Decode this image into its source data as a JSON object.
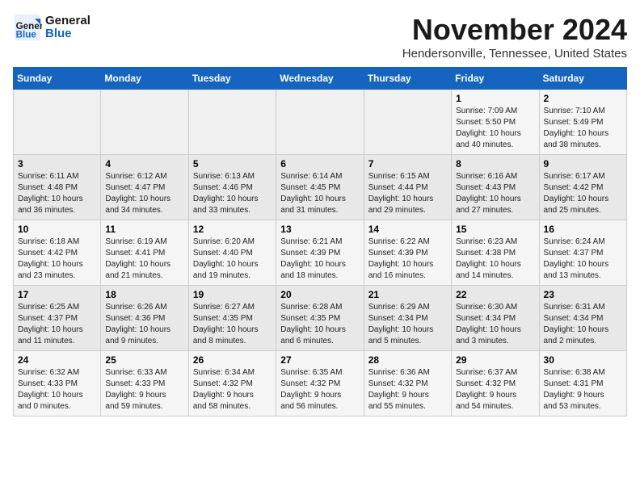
{
  "logo": {
    "line1": "General",
    "line2": "Blue"
  },
  "title": "November 2024",
  "location": "Hendersonville, Tennessee, United States",
  "days_of_week": [
    "Sunday",
    "Monday",
    "Tuesday",
    "Wednesday",
    "Thursday",
    "Friday",
    "Saturday"
  ],
  "weeks": [
    [
      {
        "num": "",
        "info": ""
      },
      {
        "num": "",
        "info": ""
      },
      {
        "num": "",
        "info": ""
      },
      {
        "num": "",
        "info": ""
      },
      {
        "num": "",
        "info": ""
      },
      {
        "num": "1",
        "info": "Sunrise: 7:09 AM\nSunset: 5:50 PM\nDaylight: 10 hours\nand 40 minutes."
      },
      {
        "num": "2",
        "info": "Sunrise: 7:10 AM\nSunset: 5:49 PM\nDaylight: 10 hours\nand 38 minutes."
      }
    ],
    [
      {
        "num": "3",
        "info": "Sunrise: 6:11 AM\nSunset: 4:48 PM\nDaylight: 10 hours\nand 36 minutes."
      },
      {
        "num": "4",
        "info": "Sunrise: 6:12 AM\nSunset: 4:47 PM\nDaylight: 10 hours\nand 34 minutes."
      },
      {
        "num": "5",
        "info": "Sunrise: 6:13 AM\nSunset: 4:46 PM\nDaylight: 10 hours\nand 33 minutes."
      },
      {
        "num": "6",
        "info": "Sunrise: 6:14 AM\nSunset: 4:45 PM\nDaylight: 10 hours\nand 31 minutes."
      },
      {
        "num": "7",
        "info": "Sunrise: 6:15 AM\nSunset: 4:44 PM\nDaylight: 10 hours\nand 29 minutes."
      },
      {
        "num": "8",
        "info": "Sunrise: 6:16 AM\nSunset: 4:43 PM\nDaylight: 10 hours\nand 27 minutes."
      },
      {
        "num": "9",
        "info": "Sunrise: 6:17 AM\nSunset: 4:42 PM\nDaylight: 10 hours\nand 25 minutes."
      }
    ],
    [
      {
        "num": "10",
        "info": "Sunrise: 6:18 AM\nSunset: 4:42 PM\nDaylight: 10 hours\nand 23 minutes."
      },
      {
        "num": "11",
        "info": "Sunrise: 6:19 AM\nSunset: 4:41 PM\nDaylight: 10 hours\nand 21 minutes."
      },
      {
        "num": "12",
        "info": "Sunrise: 6:20 AM\nSunset: 4:40 PM\nDaylight: 10 hours\nand 19 minutes."
      },
      {
        "num": "13",
        "info": "Sunrise: 6:21 AM\nSunset: 4:39 PM\nDaylight: 10 hours\nand 18 minutes."
      },
      {
        "num": "14",
        "info": "Sunrise: 6:22 AM\nSunset: 4:39 PM\nDaylight: 10 hours\nand 16 minutes."
      },
      {
        "num": "15",
        "info": "Sunrise: 6:23 AM\nSunset: 4:38 PM\nDaylight: 10 hours\nand 14 minutes."
      },
      {
        "num": "16",
        "info": "Sunrise: 6:24 AM\nSunset: 4:37 PM\nDaylight: 10 hours\nand 13 minutes."
      }
    ],
    [
      {
        "num": "17",
        "info": "Sunrise: 6:25 AM\nSunset: 4:37 PM\nDaylight: 10 hours\nand 11 minutes."
      },
      {
        "num": "18",
        "info": "Sunrise: 6:26 AM\nSunset: 4:36 PM\nDaylight: 10 hours\nand 9 minutes."
      },
      {
        "num": "19",
        "info": "Sunrise: 6:27 AM\nSunset: 4:35 PM\nDaylight: 10 hours\nand 8 minutes."
      },
      {
        "num": "20",
        "info": "Sunrise: 6:28 AM\nSunset: 4:35 PM\nDaylight: 10 hours\nand 6 minutes."
      },
      {
        "num": "21",
        "info": "Sunrise: 6:29 AM\nSunset: 4:34 PM\nDaylight: 10 hours\nand 5 minutes."
      },
      {
        "num": "22",
        "info": "Sunrise: 6:30 AM\nSunset: 4:34 PM\nDaylight: 10 hours\nand 3 minutes."
      },
      {
        "num": "23",
        "info": "Sunrise: 6:31 AM\nSunset: 4:34 PM\nDaylight: 10 hours\nand 2 minutes."
      }
    ],
    [
      {
        "num": "24",
        "info": "Sunrise: 6:32 AM\nSunset: 4:33 PM\nDaylight: 10 hours\nand 0 minutes."
      },
      {
        "num": "25",
        "info": "Sunrise: 6:33 AM\nSunset: 4:33 PM\nDaylight: 9 hours\nand 59 minutes."
      },
      {
        "num": "26",
        "info": "Sunrise: 6:34 AM\nSunset: 4:32 PM\nDaylight: 9 hours\nand 58 minutes."
      },
      {
        "num": "27",
        "info": "Sunrise: 6:35 AM\nSunset: 4:32 PM\nDaylight: 9 hours\nand 56 minutes."
      },
      {
        "num": "28",
        "info": "Sunrise: 6:36 AM\nSunset: 4:32 PM\nDaylight: 9 hours\nand 55 minutes."
      },
      {
        "num": "29",
        "info": "Sunrise: 6:37 AM\nSunset: 4:32 PM\nDaylight: 9 hours\nand 54 minutes."
      },
      {
        "num": "30",
        "info": "Sunrise: 6:38 AM\nSunset: 4:31 PM\nDaylight: 9 hours\nand 53 minutes."
      }
    ]
  ]
}
